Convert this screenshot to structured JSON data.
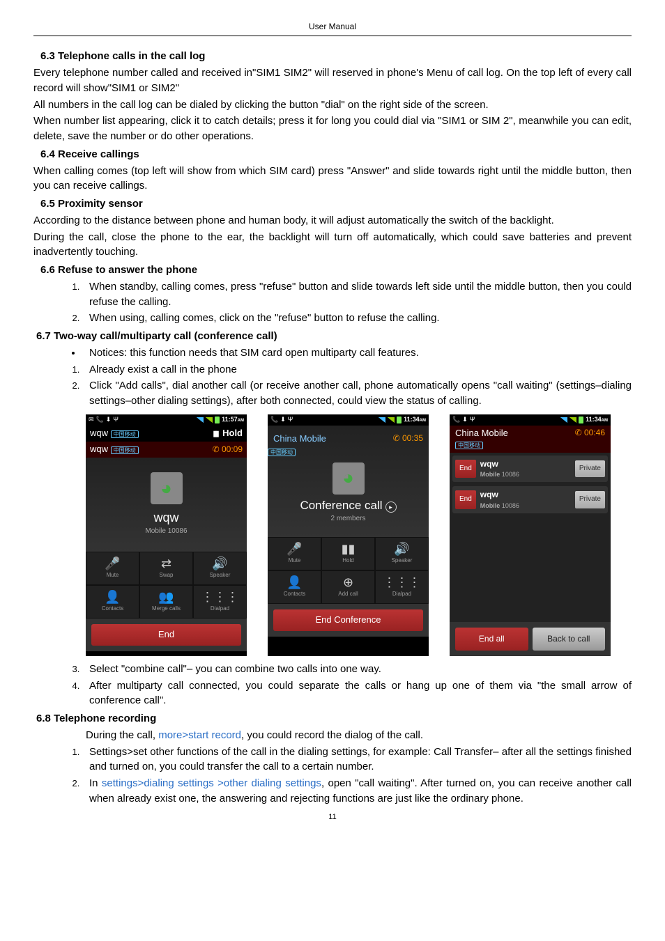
{
  "header": {
    "title": "User Manual"
  },
  "s63": {
    "title": "6.3 Telephone calls in the call log",
    "p1": "Every telephone number called and received in\"SIM1   SIM2\" will reserved in phone's Menu of call log. On the top left of every call record will show\"SIM1 or SIM2\"",
    "p2": "All numbers in the call log can be dialed by clicking the button \"dial\" on the right side of the screen.",
    "p3": "When number list appearing, click it to catch details; press it for long you could dial via \"SIM1 or SIM 2\", meanwhile you can edit, delete, save the number or do other operations."
  },
  "s64": {
    "title": "6.4 Receive callings",
    "p1": "When calling comes (top left will show from which SIM card) press \"Answer\" and slide towards right until the middle button, then you can receive callings."
  },
  "s65": {
    "title": "6.5 Proximity sensor",
    "p1": "According to the distance between phone and human body, it will adjust automatically the switch of the backlight.",
    "p2": "During the call, close the phone to the ear, the backlight will turn off automatically, which could save batteries and prevent inadvertently touching."
  },
  "s66": {
    "title": "6.6 Refuse to answer the phone",
    "li1": "When standby, calling comes, press \"refuse\" button and slide towards left side until the middle button, then you could refuse the calling.",
    "li2": "When using, calling comes, click on the \"refuse\" button to refuse the calling."
  },
  "s67": {
    "title": "6.7 Two-way call/multiparty call (conference call)",
    "b1": "Notices: this function needs that SIM card open multiparty call features.",
    "li1": "Already exist a call in the phone",
    "li2": "Click \"Add calls\", dial another call (or receive another call, phone automatically opens \"call waiting\" (settings–dialing settings–other dialing settings), after both connected, could view the status of calling.",
    "li3": "Select \"combine call\"– you can combine two calls into one way.",
    "li4": "After multiparty call connected, you could separate the calls or hang up one of them via \"the small arrow of conference call\"."
  },
  "s68": {
    "title": "6.8 Telephone recording",
    "p1a": "During the call, ",
    "p1_link": "more>start record",
    "p1b": ", you could record the dialog of the call.",
    "li1": "Settings>set other functions of the call in the dialing settings, for example: Call Transfer– after all the settings finished and turned on, you could transfer the call to a certain number.",
    "li2a": "In ",
    "li2_link": "settings>dialing settings >other dialing settings",
    "li2b": ", open \"call waiting\". After turned on, you can receive another call when already exist one, the answering and rejecting functions are just like the ordinary phone."
  },
  "screens": {
    "a": {
      "time": "11:57",
      "am": "AM",
      "row1_name": "wqw",
      "row1_tag": "中国移动",
      "row1_hold": "Hold",
      "row2_name": "wqw",
      "row2_tag": "中国移动",
      "row2_dur": "00:09",
      "caller": "wqw",
      "caller_sub": "Mobile 10086",
      "btn_mute": "Mute",
      "btn_swap": "Swap",
      "btn_speaker": "Speaker",
      "btn_contacts": "Contacts",
      "btn_merge": "Merge calls",
      "btn_dialpad": "Dialpad",
      "end": "End"
    },
    "b": {
      "time": "11:34",
      "am": "AM",
      "carrier": "China Mobile",
      "tag": "中国移动",
      "dur": "00:35",
      "conf_title": "Conference call",
      "conf_sub": "2 members",
      "btn_mute": "Mute",
      "btn_hold": "Hold",
      "btn_speaker": "Speaker",
      "btn_contacts": "Contacts",
      "btn_add": "Add call",
      "btn_dialpad": "Dialpad",
      "end": "End Conference"
    },
    "c": {
      "time": "11:34",
      "am": "AM",
      "carrier": "China Mobile",
      "tag": "中国移动",
      "dur": "00:46",
      "row_end": "End",
      "row_name": "wqw",
      "row_sub": "Mobile 10086",
      "row_priv": "Private",
      "end_all": "End all",
      "back": "Back to call"
    }
  },
  "page_number": "11"
}
